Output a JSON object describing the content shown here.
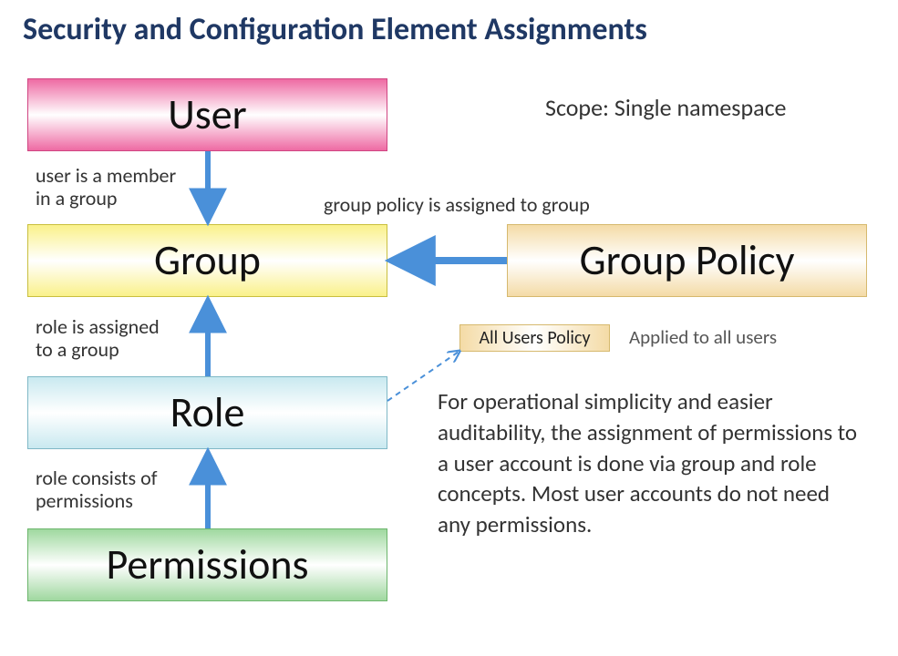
{
  "title": "Security and Configuration Element Assignments",
  "scope": "Scope: Single namespace",
  "boxes": {
    "user": "User",
    "group": "Group",
    "role": "Role",
    "permissions": "Permissions",
    "group_policy": "Group Policy",
    "all_users_policy": "All Users Policy"
  },
  "labels": {
    "user_to_group": "user is a member\nin a group",
    "role_to_group": "role is assigned\nto a group",
    "perm_to_role": "role consists of\npermissions",
    "gpol_to_group": "group policy is assigned to group",
    "aup_applied": "Applied to all users"
  },
  "description": "For operational simplicity and easier auditability, the assignment of permissions to a user account is done via group and role concepts. Most user accounts do not need any permissions.",
  "arrows": [
    {
      "from": "user",
      "to": "group",
      "style": "solid"
    },
    {
      "from": "role",
      "to": "group",
      "style": "solid"
    },
    {
      "from": "permissions",
      "to": "role",
      "style": "solid"
    },
    {
      "from": "group_policy",
      "to": "group",
      "style": "solid"
    },
    {
      "from": "role",
      "to": "all_users_policy",
      "style": "dashed"
    }
  ]
}
